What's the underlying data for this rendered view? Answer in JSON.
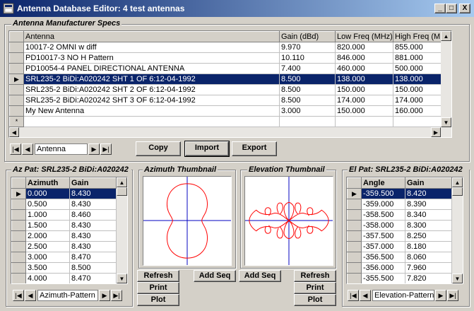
{
  "window": {
    "title": "Antenna Database Editor: 4 test antennas",
    "minimize": "_",
    "maximize": "□",
    "close": "X"
  },
  "specs": {
    "group_label": "Antenna Manufacturer Specs",
    "columns": [
      "Antenna",
      "Gain (dBd)",
      "Low Freq (MHz)",
      "High Freq (MHz)"
    ],
    "rows": [
      [
        "10017-2 OMNI w diff",
        "9.970",
        "820.000",
        "855.000"
      ],
      [
        "PD10017-3 NO H Pattern",
        "10.110",
        "846.000",
        "881.000"
      ],
      [
        "PD10054-4 PANEL DIRECTIONAL ANTENNA",
        "7.400",
        "460.000",
        "500.000"
      ],
      [
        "SRL235-2 BiDi:A020242 SHT 1 OF 6:12-04-1992",
        "8.500",
        "138.000",
        "138.000"
      ],
      [
        "SRL235-2 BiDi:A020242 SHT 2 OF 6:12-04-1992",
        "8.500",
        "150.000",
        "150.000"
      ],
      [
        "SRL235-2 BiDi:A020242 SHT 3 OF 6:12-04-1992",
        "8.500",
        "174.000",
        "174.000"
      ],
      [
        "My New Antenna",
        "3.000",
        "150.000",
        "160.000"
      ]
    ],
    "selected_row": 3,
    "new_row_marker": "*",
    "nav_label": "Antenna",
    "buttons": {
      "copy": "Copy",
      "import": "Import",
      "export": "Export"
    }
  },
  "az": {
    "group_label": "Az Pat: SRL235-2 BiDi:A020242",
    "columns": [
      "Azimuth",
      "Gain"
    ],
    "rows": [
      [
        "0.000",
        "8.430"
      ],
      [
        "0.500",
        "8.430"
      ],
      [
        "1.000",
        "8.460"
      ],
      [
        "1.500",
        "8.430"
      ],
      [
        "2.000",
        "8.430"
      ],
      [
        "2.500",
        "8.430"
      ],
      [
        "3.000",
        "8.470"
      ],
      [
        "3.500",
        "8.500"
      ],
      [
        "4.000",
        "8.470"
      ]
    ],
    "nav_label": "Azimuth-Pattern"
  },
  "az_thumb": {
    "group_label": "Azimuth Thumbnail"
  },
  "el_thumb": {
    "group_label": "Elevation Thumbnail"
  },
  "el": {
    "group_label": "El Pat: SRL235-2 BiDi:A020242",
    "columns": [
      "Angle",
      "Gain"
    ],
    "rows": [
      [
        "-359.500",
        "8.420"
      ],
      [
        "-359.000",
        "8.390"
      ],
      [
        "-358.500",
        "8.340"
      ],
      [
        "-358.000",
        "8.300"
      ],
      [
        "-357.500",
        "8.250"
      ],
      [
        "-357.000",
        "8.180"
      ],
      [
        "-356.500",
        "8.060"
      ],
      [
        "-356.000",
        "7.960"
      ],
      [
        "-355.500",
        "7.820"
      ]
    ],
    "nav_label": "Elevation-Pattern"
  },
  "buttons": {
    "refresh": "Refresh",
    "print": "Print",
    "plot": "Plot",
    "add_seq": "Add Seq"
  },
  "glyphs": {
    "first": "|◀",
    "prev": "◀",
    "next": "▶",
    "last": "▶|",
    "up": "▲",
    "down": "▼",
    "left": "◀",
    "right": "▶",
    "current": "▶"
  },
  "colors": {
    "title_start": "#0a246a",
    "title_end": "#a6caf0",
    "selection": "#0a246a",
    "pattern": "#ff0000",
    "axes": "#0000c0"
  }
}
